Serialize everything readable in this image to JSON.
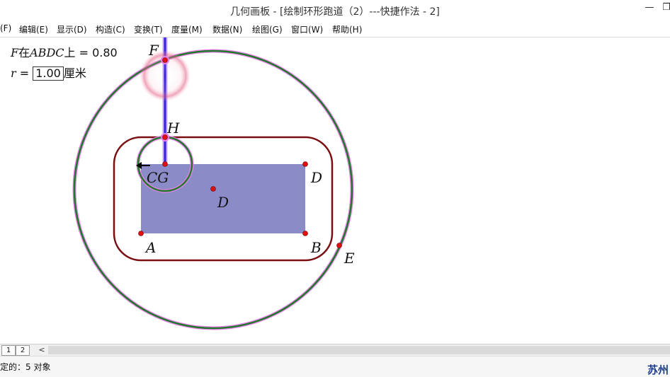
{
  "window": {
    "title": "几何画板 - [绘制环形跑道（2）---快捷作法 - 2]",
    "minimize_glyph": "—",
    "restore_glyph": "❐"
  },
  "menu": {
    "items": [
      {
        "label": "(F)"
      },
      {
        "label": "编辑(E)"
      },
      {
        "label": "显示(D)"
      },
      {
        "label": "构造(C)"
      },
      {
        "label": "变换(T)"
      },
      {
        "label": "度量(M)"
      },
      {
        "label": "数据(N)"
      },
      {
        "label": "绘图(G)"
      },
      {
        "label": "窗口(W)"
      },
      {
        "label": "帮助(H)"
      }
    ]
  },
  "measurements": {
    "f_point": "F",
    "on_text": "在",
    "path_name": "ABDC",
    "suffix": "上 = 0.80",
    "r_name": "r",
    "r_eq": " = ",
    "r_value": "1.00",
    "r_unit": "厘米"
  },
  "points": {
    "F": "F",
    "H": "H",
    "CG": "CG",
    "D_top": "D",
    "D_center": "D",
    "A": "A",
    "B": "B",
    "E": "E"
  },
  "colors": {
    "rect_fill": "#8B8CC7",
    "track_dark_red": "#7A0F12",
    "track_green": "#1E7A2A",
    "track_pink": "#E87FE8",
    "point_red": "#E01010",
    "segment_blue": "#3522D8",
    "highlight_pink": "#E25A82",
    "status_accent": "#1D3D8C"
  },
  "tabs": {
    "t1": "1",
    "t2": "2",
    "scroll_left": "<"
  },
  "status": {
    "text": "定的：5 对象",
    "right": "苏州"
  }
}
